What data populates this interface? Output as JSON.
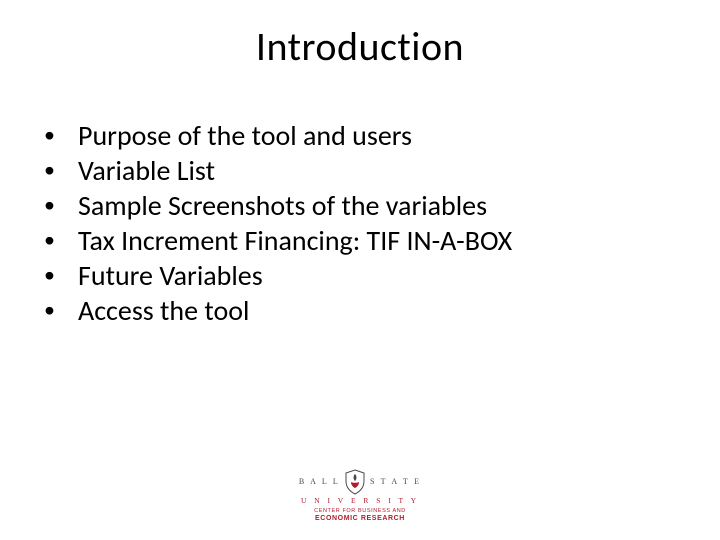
{
  "title": "Introduction",
  "bullets": [
    "Purpose of the tool and users",
    "Variable List",
    "Sample Screenshots of the variables",
    "Tax Increment Financing: TIF IN-A-BOX",
    "Future Variables",
    "Access the tool"
  ],
  "logo": {
    "line1_left": "B A L L",
    "line1_right": "S T A T E",
    "line2": "U N I V E R S I T Y",
    "sub1": "CENTER FOR BUSINESS AND",
    "sub2": "ECONOMIC RESEARCH",
    "accent": "#b01c2e"
  }
}
